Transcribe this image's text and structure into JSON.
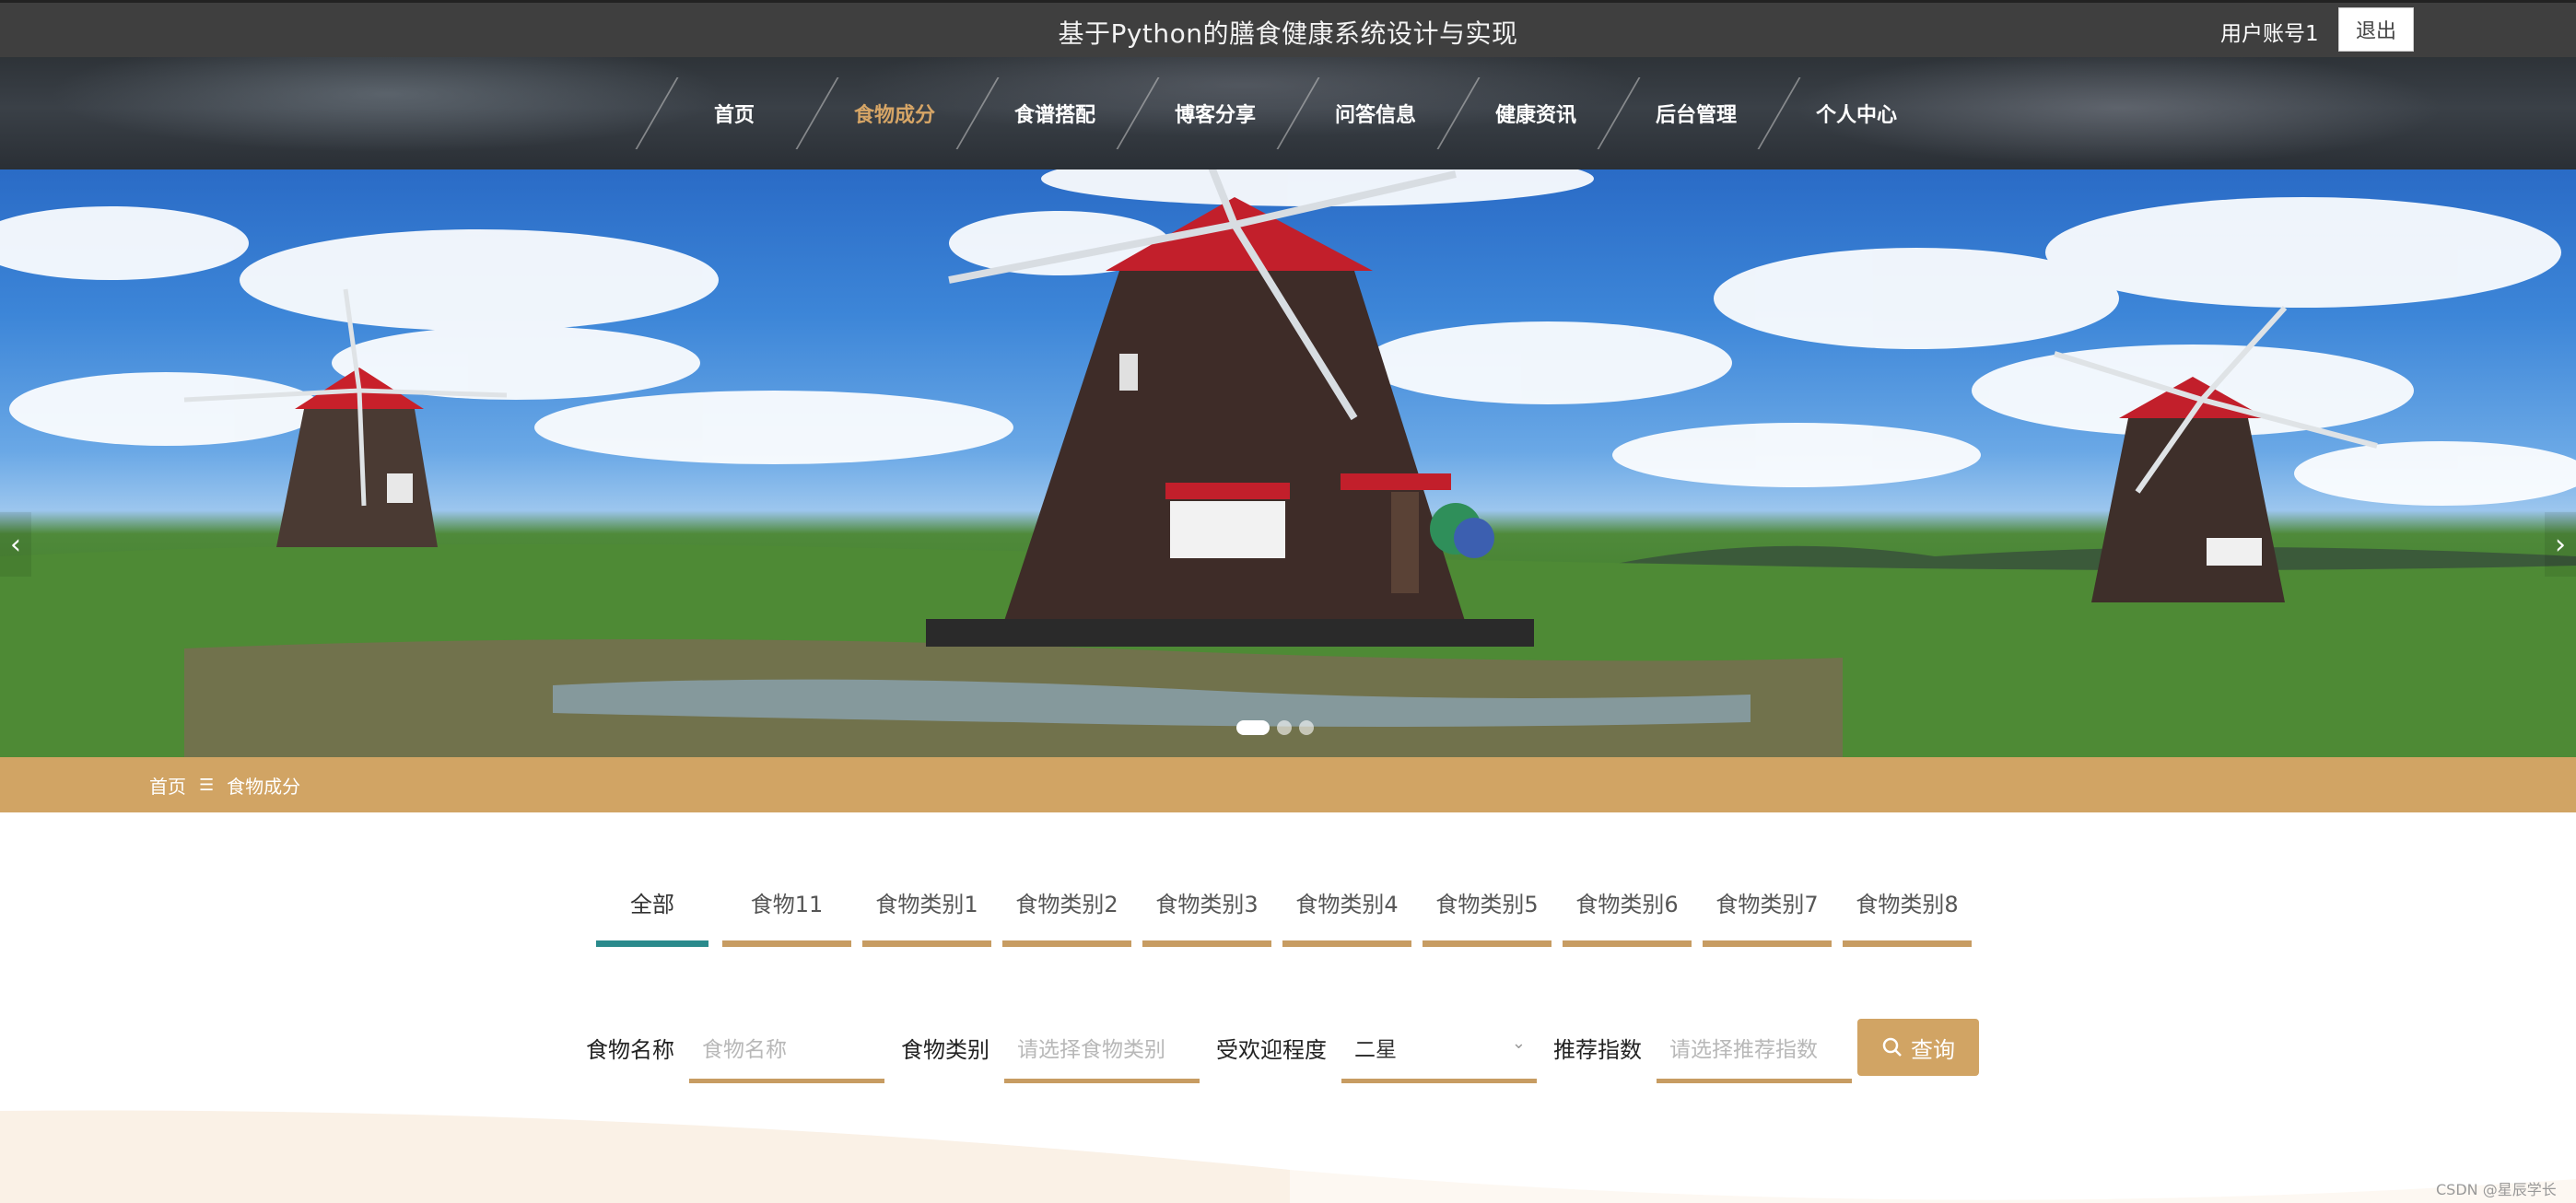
{
  "header": {
    "title": "基于Python的膳食健康系统设计与实现",
    "user": "用户账号1",
    "logout": "退出"
  },
  "nav": {
    "items": [
      {
        "label": "首页",
        "active": false
      },
      {
        "label": "食物成分",
        "active": true
      },
      {
        "label": "食谱搭配",
        "active": false
      },
      {
        "label": "博客分享",
        "active": false
      },
      {
        "label": "问答信息",
        "active": false
      },
      {
        "label": "健康资讯",
        "active": false
      },
      {
        "label": "后台管理",
        "active": false
      },
      {
        "label": "个人中心",
        "active": false
      }
    ]
  },
  "banner": {
    "prev": "‹",
    "next": "›",
    "slides": 3,
    "active_slide": 1
  },
  "breadcrumb": {
    "home": "首页",
    "separator": "☰",
    "current": "食物成分"
  },
  "tabs": [
    "全部",
    "食物11",
    "食物类别1",
    "食物类别2",
    "食物类别3",
    "食物类别4",
    "食物类别5",
    "食物类别6",
    "食物类别7",
    "食物类别8"
  ],
  "filters": {
    "name_label": "食物名称",
    "name_placeholder": "食物名称",
    "category_label": "食物类别",
    "category_placeholder": "请选择食物类别",
    "popularity_label": "受欢迎程度",
    "popularity_value": "二星",
    "recommend_label": "推荐指数",
    "recommend_placeholder": "请选择推荐指数",
    "search_button": "查询"
  },
  "watermark": "CSDN @星辰学长",
  "colors": {
    "accent": "#d1a464",
    "tab_active": "#2a8a8c",
    "topbar": "#3f3f3f"
  }
}
